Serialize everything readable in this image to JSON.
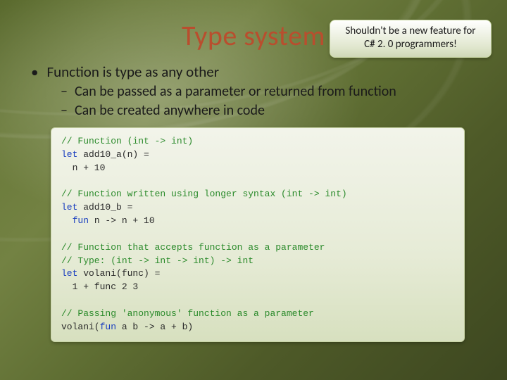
{
  "title": "Type system",
  "callout": {
    "line1": "Shouldn't be a new feature for",
    "line2": "C# 2. 0 programmers!"
  },
  "bullets": {
    "main": "Function is type as any other",
    "sub1": "Can be passed as a parameter or returned from function",
    "sub2": "Can be created anywhere in code"
  },
  "code": {
    "c1": "// Function (int -> int)",
    "l1a": "let",
    "l1b": " add10_a(n) =",
    "l2": "  n + 10",
    "c2": "// Function written using longer syntax (int -> int)",
    "l3a": "let",
    "l3b": " add10_b =",
    "l4a": "  ",
    "l4b": "fun",
    "l4c": " n -> n + 10",
    "c3": "// Function that accepts function as a parameter",
    "c4": "// Type: (int -> int -> int) -> int",
    "l5a": "let",
    "l5b": " volani(func) =",
    "l6": "  1 + func 2 3",
    "c5": "// Passing 'anonymous' function as a parameter",
    "l7a": "volani(",
    "l7b": "fun",
    "l7c": " a b -> a + b)"
  }
}
